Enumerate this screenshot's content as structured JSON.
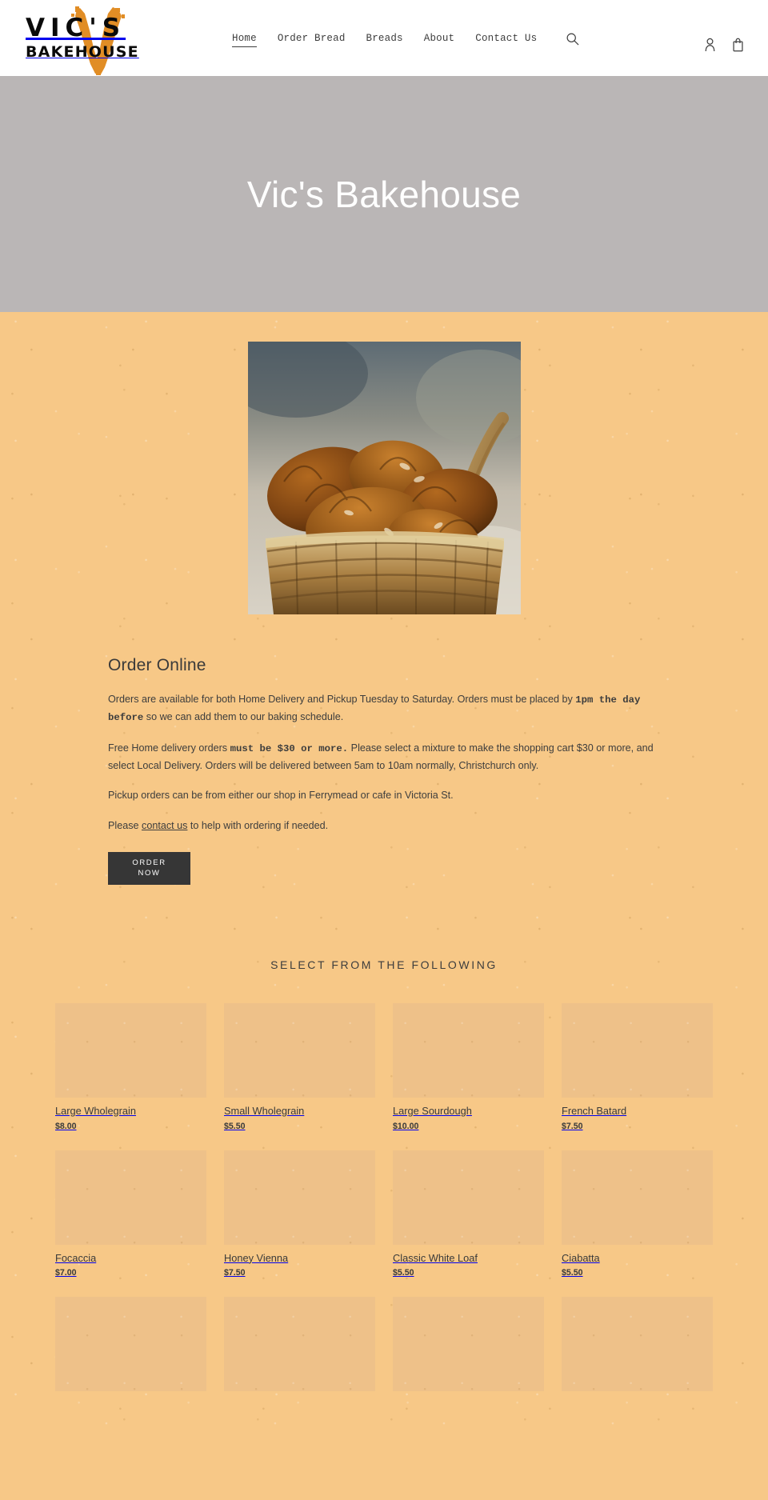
{
  "header": {
    "logo": {
      "line1": "VIC'S",
      "line2": "BAKEHOUSE",
      "brush_color": "#e18d25"
    },
    "nav": [
      {
        "label": "Home",
        "active": true
      },
      {
        "label": "Order Bread",
        "active": false
      },
      {
        "label": "Breads",
        "active": false
      },
      {
        "label": "About",
        "active": false
      },
      {
        "label": "Contact Us",
        "active": false
      }
    ],
    "icons": {
      "search": "search-icon",
      "account": "account-icon",
      "cart": "cart-icon"
    }
  },
  "hero": {
    "title": "Vic's Bakehouse",
    "background_color": "#bab6b6",
    "text_color": "#ffffff"
  },
  "hero_image": {
    "alt": "Basket of freshly baked croissants and pastries"
  },
  "order_section": {
    "heading": "Order Online",
    "paragraph1_before": "Orders are available for both Home Delivery and Pickup Tuesday to Saturday.  Orders must be placed by ",
    "paragraph1_bold": "1pm the day before",
    "paragraph1_after": " so we can add them to our baking schedule.",
    "paragraph2_before": "Free Home delivery orders ",
    "paragraph2_bold": "must be $30 or more.",
    "paragraph2_after": "  Please select a mixture to make the shopping cart $30 or more, and select Local Delivery. Orders will be delivered between 5am to 10am normally, Christchurch only.",
    "paragraph3": "Pickup orders can be from either our shop in Ferrymead or cafe in Victoria St.",
    "paragraph4_before": "Please ",
    "paragraph4_link": "contact us",
    "paragraph4_after": " to help with ordering if needed.",
    "button_line1": "ORDER",
    "button_line2": "NOW",
    "button_color": "#363636"
  },
  "collection": {
    "title": "SELECT FROM THE FOLLOWING",
    "products": [
      {
        "name": "Large Wholegrain",
        "price": "$8.00"
      },
      {
        "name": "Small Wholegrain",
        "price": "$5.50"
      },
      {
        "name": "Large Sourdough",
        "price": "$10.00"
      },
      {
        "name": "French Batard",
        "price": "$7.50"
      },
      {
        "name": "Focaccia",
        "price": "$7.00"
      },
      {
        "name": "Honey Vienna",
        "price": "$7.50"
      },
      {
        "name": "Classic White Loaf",
        "price": "$5.50"
      },
      {
        "name": "Ciabatta",
        "price": "$5.50"
      },
      {
        "name": "",
        "price": ""
      },
      {
        "name": "",
        "price": ""
      },
      {
        "name": "",
        "price": ""
      },
      {
        "name": "",
        "price": ""
      }
    ]
  },
  "theme": {
    "page_background": "#f7c887",
    "text_color": "#3a3a3a"
  }
}
